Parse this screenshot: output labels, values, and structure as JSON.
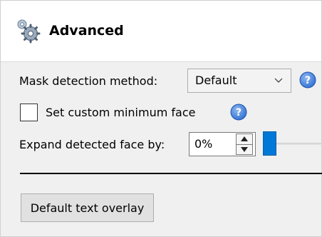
{
  "header": {
    "title": "Advanced",
    "icon": "gears-icon"
  },
  "mask_detection": {
    "label": "Mask detection method:",
    "selected": "Default",
    "help_icon": "question-help-icon"
  },
  "custom_minimum_face": {
    "label": "Set custom minimum face",
    "checked": false,
    "help_icon": "question-help-icon"
  },
  "expand_face": {
    "label": "Expand detected face by:",
    "value": "0%"
  },
  "overlay_button": {
    "label": "Default text overlay"
  },
  "colors": {
    "accent": "#0078d7",
    "help_icon": "#2f6fd1",
    "panel_bg": "#f0f0f0",
    "header_bg": "#ffffff"
  }
}
